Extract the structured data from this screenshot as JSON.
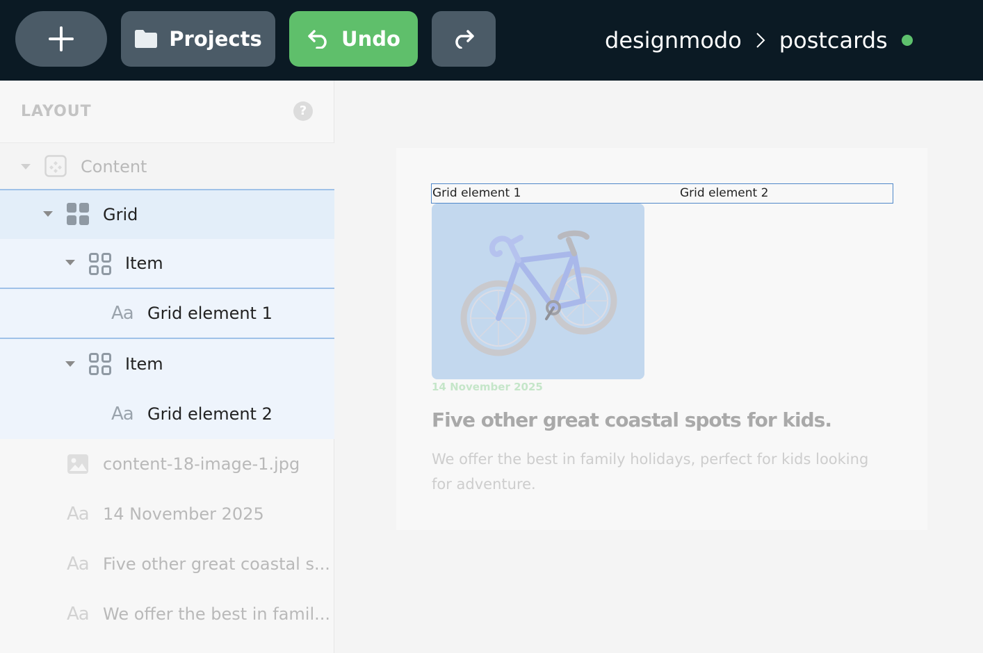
{
  "toolbar": {
    "projects_label": "Projects",
    "undo_label": "Undo",
    "breadcrumb": [
      "designmodo",
      "postcards"
    ],
    "status_color": "#5ec16d",
    "undo_color": "#5fbf6b"
  },
  "sidebar": {
    "title": "LAYOUT",
    "help": "?",
    "items": [
      {
        "label": "Content",
        "icon": "content-block-icon"
      },
      {
        "label": "Grid",
        "icon": "grid-icon"
      },
      {
        "label": "Item",
        "icon": "item-grid-icon"
      },
      {
        "label": "Grid element 1",
        "icon": "text-icon"
      },
      {
        "label": "Item",
        "icon": "item-grid-icon"
      },
      {
        "label": "Grid element 2",
        "icon": "text-icon"
      },
      {
        "label": "content-18-image-1.jpg",
        "icon": "image-icon"
      },
      {
        "label": "14 November 2025",
        "icon": "text-icon"
      },
      {
        "label": "Five other great coastal s...",
        "icon": "text-icon"
      },
      {
        "label": "We offer the best in famil...",
        "icon": "text-icon"
      }
    ],
    "text_glyph": "Aa"
  },
  "canvas": {
    "grid_element_1": "Grid element 1",
    "grid_element_2": "Grid element 2",
    "date": "14 November 2025",
    "heading": "Five other great coastal spots for kids.",
    "description": "We offer the best in family holidays, perfect for kids looking for adventure."
  }
}
